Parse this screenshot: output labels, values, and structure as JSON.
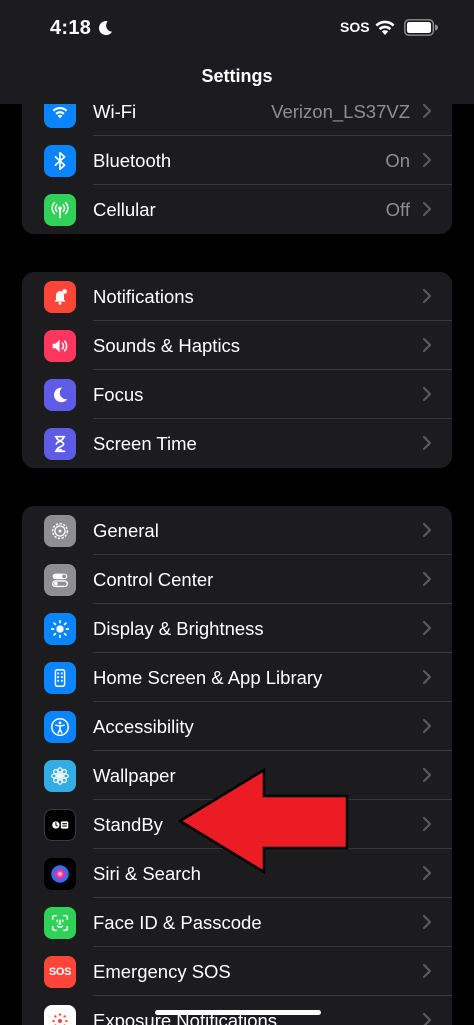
{
  "status_bar": {
    "time": "4:18",
    "carrier_badge": "SOS"
  },
  "nav": {
    "title": "Settings"
  },
  "groups": [
    {
      "name": "connectivity",
      "items": [
        {
          "label": "Wi-Fi",
          "value": "Verizon_LS37VZ",
          "icon": "wifi-icon",
          "color": "#0a84ff"
        },
        {
          "label": "Bluetooth",
          "value": "On",
          "icon": "bluetooth-icon",
          "color": "#0a84ff"
        },
        {
          "label": "Cellular",
          "value": "Off",
          "icon": "cellular-icon",
          "color": "#30d158"
        }
      ]
    },
    {
      "name": "notifications",
      "items": [
        {
          "label": "Notifications",
          "icon": "bell-icon",
          "color": "#ff453a"
        },
        {
          "label": "Sounds & Haptics",
          "icon": "speaker-icon",
          "color": "#ff375f"
        },
        {
          "label": "Focus",
          "icon": "moon-icon",
          "color": "#5e5ce6"
        },
        {
          "label": "Screen Time",
          "icon": "hourglass-icon",
          "color": "#5e5ce6"
        }
      ]
    },
    {
      "name": "general",
      "items": [
        {
          "label": "General",
          "icon": "gear-icon",
          "color": "#8e8e93"
        },
        {
          "label": "Control Center",
          "icon": "toggles-icon",
          "color": "#8e8e93"
        },
        {
          "label": "Display & Brightness",
          "icon": "sun-icon",
          "color": "#0a84ff"
        },
        {
          "label": "Home Screen & App Library",
          "icon": "home-screen-icon",
          "color": "#0a84ff"
        },
        {
          "label": "Accessibility",
          "icon": "accessibility-icon",
          "color": "#0a84ff"
        },
        {
          "label": "Wallpaper",
          "icon": "flower-icon",
          "color": "#32ade6"
        },
        {
          "label": "StandBy",
          "icon": "standby-icon",
          "color": "#000000"
        },
        {
          "label": "Siri & Search",
          "icon": "siri-icon",
          "color": "#1c1c1e"
        },
        {
          "label": "Face ID & Passcode",
          "icon": "faceid-icon",
          "color": "#30d158"
        },
        {
          "label": "Emergency SOS",
          "icon": "sos-icon",
          "color": "#ff453a",
          "icon_text": "SOS"
        },
        {
          "label": "Exposure Notifications",
          "icon": "exposure-icon",
          "color": "#ffffff"
        }
      ]
    }
  ],
  "annotation": {
    "arrow_color": "#ec1c24",
    "points_to": "StandBy"
  }
}
